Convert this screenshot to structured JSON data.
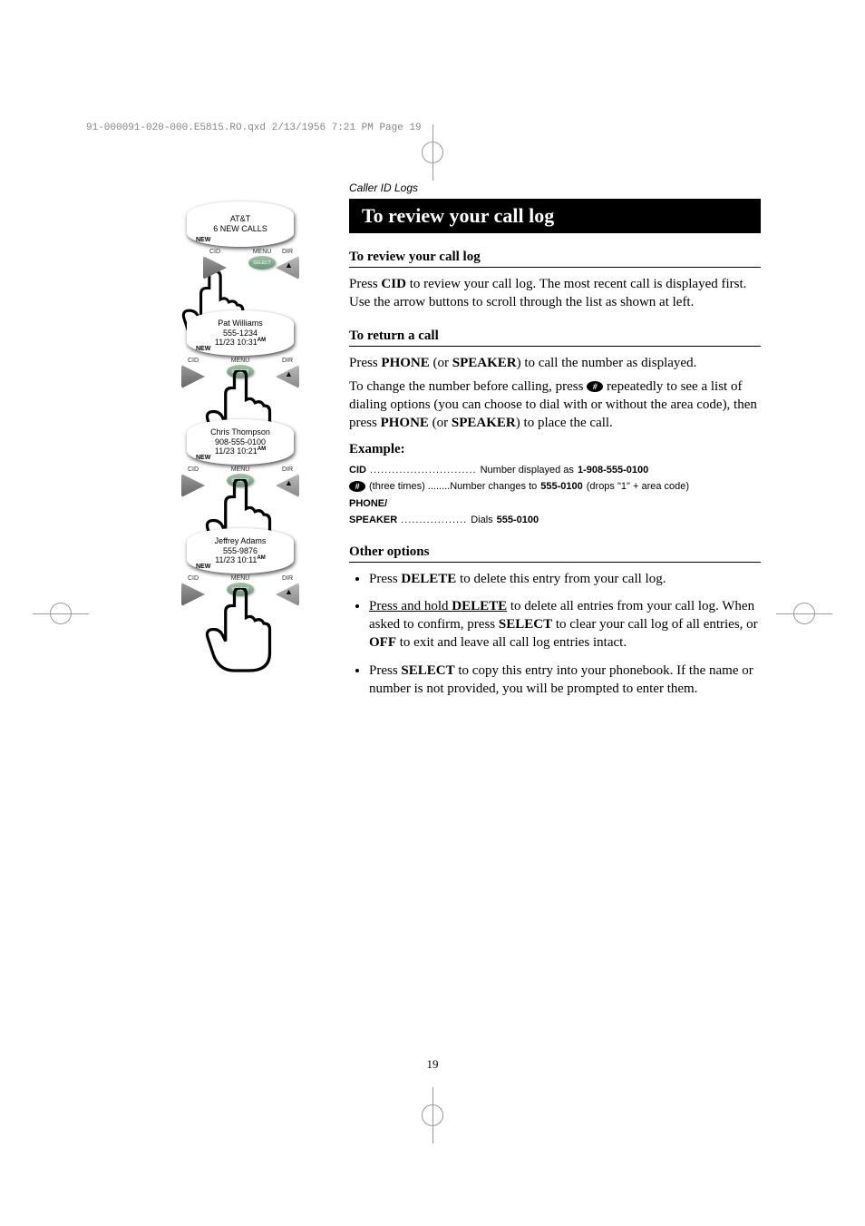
{
  "print_header": "91-000091-020-000.E5815.RO.qxd  2/13/1956  7:21 PM  Page 19",
  "category": "Caller ID Logs",
  "title": "To review your call log",
  "page_number": "19",
  "screens": [
    {
      "line1": "AT&T",
      "line2": "6 NEW CALLS",
      "line3": "",
      "ampm": "",
      "new": "NEW"
    },
    {
      "line1": "Pat Williams",
      "line2": "555-1234",
      "line3": "11/23 10:31",
      "ampm": "AM",
      "new": "NEW"
    },
    {
      "line1": "Chris Thompson",
      "line2": "908-555-0100",
      "line3": "11/23 10:21",
      "ampm": "AM",
      "new": "NEW"
    },
    {
      "line1": "Jeffrey Adams",
      "line2": "555-9876",
      "line3": "11/23 10:11",
      "ampm": "AM",
      "new": "NEW"
    }
  ],
  "button_labels": {
    "cid": "CID",
    "menu": "MENU",
    "dir": "DIR",
    "select": "SELECT"
  },
  "sections": {
    "review": {
      "heading": "To review your call log",
      "para_pre": "Press ",
      "para_key": "CID",
      "para_post": " to review your call log. The most recent call is displayed first. Use the arrow buttons to scroll through the list as shown at left."
    },
    "return": {
      "heading": "To return a call",
      "p1_pre": "Press ",
      "p1_k1": "PHONE",
      "p1_mid": " (or ",
      "p1_k2": "SPEAKER",
      "p1_post": ") to call the number as displayed.",
      "p2_pre": "To change the number before calling, press ",
      "p2_mid": " repeatedly to see a list of dialing options (you can choose to dial with or without the area code), then press ",
      "p2_k": "PHONE",
      "p2_mid2": " (or ",
      "p2_k2": "SPEAKER",
      "p2_post": ") to place the call."
    },
    "example": {
      "heading": "Example:",
      "r1_key": "CID",
      "r1_dots": ".............................",
      "r1_txt": "Number displayed as ",
      "r1_val": "1-908-555-0100",
      "r2_note": " (three times) ........Number changes to ",
      "r2_val": "555-0100",
      "r2_post": " (drops \"1\" + area code)",
      "r3_k1": "PHONE/",
      "r3_k2": "SPEAKER",
      "r3_dots": " ..................",
      "r3_txt": "Dials ",
      "r3_val": "555-0100"
    },
    "other": {
      "heading": "Other options",
      "li1_pre": "Press ",
      "li1_k": "DELETE",
      "li1_post": " to delete this entry from your call log.",
      "li2_pre": "Press and hold ",
      "li2_k": "DELETE",
      "li2_mid": " to delete all entries from your call log. When asked to confirm, press ",
      "li2_k2": "SELECT",
      "li2_mid2": " to clear your call log of all entries, or ",
      "li2_k3": "OFF",
      "li2_post": " to exit and leave all call log entries intact.",
      "li3_pre": "Press ",
      "li3_k": "SELECT",
      "li3_post": " to copy this entry into your phonebook. If the name or number is not provided, you will be prompted to enter them."
    }
  }
}
